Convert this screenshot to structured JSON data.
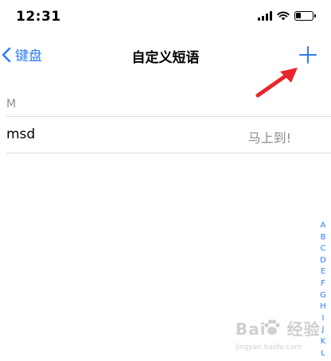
{
  "status_bar": {
    "time": "12:31",
    "battery_level": 0.3
  },
  "nav": {
    "back_label": "键盘",
    "title": "自定义短语",
    "add_icon": "plus-icon"
  },
  "section": {
    "header": "M",
    "rows": [
      {
        "shortcut": "msd",
        "phrase": "马上到!"
      }
    ]
  },
  "index_bar": [
    "A",
    "B",
    "C",
    "D",
    "E",
    "F",
    "G",
    "H",
    "I",
    "J",
    "K",
    "L"
  ],
  "watermark": {
    "brand_left": "Bai",
    "brand_right": "经验",
    "url": "jingyan.baidu.com"
  },
  "colors": {
    "accent": "#2f7cf6",
    "secondary_text": "#8e8e93",
    "annotation_arrow": "#e8262b"
  }
}
